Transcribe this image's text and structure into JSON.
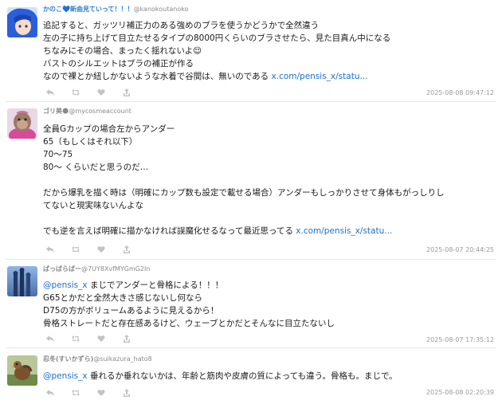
{
  "posts": [
    {
      "name": "かのこ💙新曲見ていって！！！",
      "handle": "@kanokoutanoko",
      "lines": [
        "追記すると、ガッツリ補正力のある強めのブラを使うかどうかで全然違う",
        "左の子に持ち上げて目立たせるタイプの8000円くらいのブラさせたら、見た目真ん中になる",
        "ちなみにその場合、まったく揺れないよ😌",
        "バストのシルエットはブラの補正が作る"
      ],
      "last_line": "なので裸とか紐しかないような水着で谷間は、無いのである ",
      "link": "x.com/pensis_x/statu...",
      "timestamp": "2025-08-08 09:47:12"
    },
    {
      "name": "ゴリ美🌑",
      "handle": "@mycosmeaccount",
      "lines": [
        "全員Gカップの場合左からアンダー",
        "65（もしくはそれ以下）",
        "70〜75",
        "80〜 くらいだと思うのだ…",
        "",
        "だから爆乳を描く時は（明確にカップ数も設定で載せる場合）アンダーもしっかりさせて身体もがっしりし",
        "てないと現実味ないんよな",
        ""
      ],
      "last_line": "でも逆を言えば明確に描かなければ誤魔化せるなって最近思ってる ",
      "link": "x.com/pensis_x/statu...",
      "timestamp": "2025-08-07 20:44:25"
    },
    {
      "name": "ぱっぱらぱー",
      "handle": "@7UY8XvfMYGmG2In",
      "mention": "@pensis_x",
      "first_line_rest": " まじでアンダーと骨格による！！！",
      "lines": [
        "G65とかだと全然大きさ感じないし何なら",
        "D75の方がボリュームあるように見えるから！",
        "骨格ストレートだと存在感あるけど、ウェーブとかだとそんなに目立たないし"
      ],
      "timestamp": "2025-08-07 17:35:12"
    },
    {
      "name": "忍冬(すいかずら)",
      "handle": "@suikazura_hato8",
      "mention": "@pensis_x",
      "first_line_rest": " 垂れるか垂れないかは、年齢と筋肉や皮膚の質によっても違う。骨格も。まじで。",
      "timestamp": "2025-08-08 02:20:39"
    }
  ],
  "icons": {
    "reply": "reply-icon",
    "retweet": "retweet-icon",
    "like": "heart-icon",
    "share": "share-icon"
  },
  "colors": {
    "link": "#1d6fd1",
    "name_blue": "#2d7fd3",
    "muted": "#9a9a9a"
  }
}
